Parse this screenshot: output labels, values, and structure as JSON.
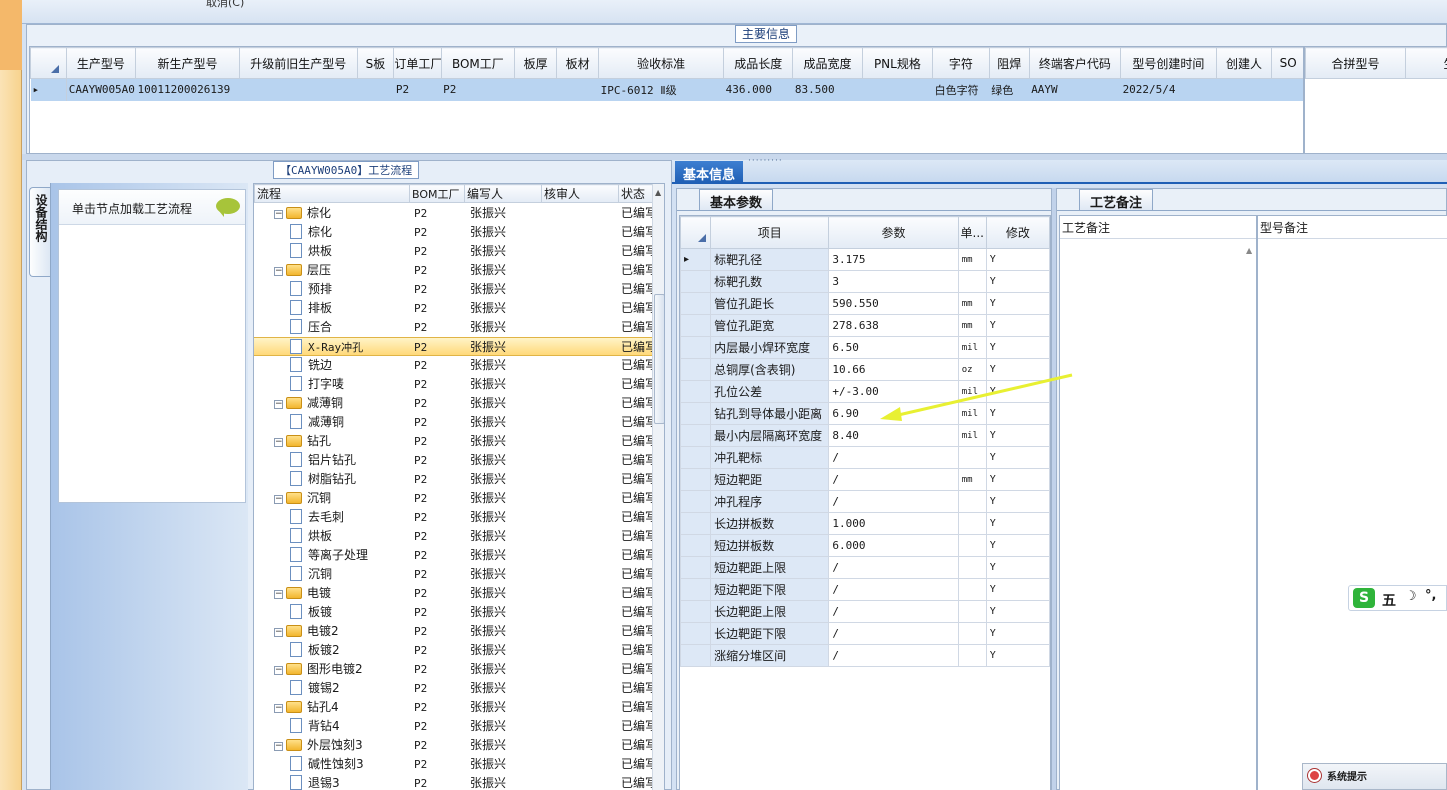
{
  "top_menu": {
    "cancel_label": "取消(C)"
  },
  "main_info": {
    "title": "主要信息",
    "columns": [
      "生产型号",
      "新生产型号",
      "升级前旧生产型号",
      "S板",
      "订单工厂",
      "BOM工厂",
      "板厚",
      "板材",
      "验收标准",
      "成品长度",
      "成品宽度",
      "PNL规格",
      "字符",
      "阻焊",
      "终端客户代码",
      "型号创建时间",
      "创建人",
      "SO"
    ],
    "row": [
      "CAAYW005A0",
      "10011200026139",
      "",
      "",
      "P2",
      "P2",
      "",
      "",
      "IPC-6012 Ⅱ级",
      "436.000",
      "83.500",
      "",
      "白色字符",
      "绿色",
      "AAYW",
      "2022/5/4",
      "",
      ""
    ],
    "right_columns": [
      "合拼型号",
      "生产"
    ]
  },
  "process": {
    "title": "【CAAYW005A0】工艺流程",
    "side_tab": "设备结构",
    "load_hint": "单击节点加载工艺流程",
    "columns": [
      "流程",
      "BOM工厂",
      "编写人",
      "核审人",
      "状态"
    ],
    "rows": [
      {
        "label": "棕化",
        "type": "folder",
        "bom": "P2",
        "writer": "张振兴",
        "reviewer": "",
        "status": "已编写"
      },
      {
        "label": "棕化",
        "type": "doc",
        "bom": "P2",
        "writer": "张振兴",
        "reviewer": "",
        "status": "已编写"
      },
      {
        "label": "烘板",
        "type": "doc",
        "bom": "P2",
        "writer": "张振兴",
        "reviewer": "",
        "status": "已编写"
      },
      {
        "label": "层压",
        "type": "folder",
        "bom": "P2",
        "writer": "张振兴",
        "reviewer": "",
        "status": "已编写"
      },
      {
        "label": "预排",
        "type": "doc",
        "bom": "P2",
        "writer": "张振兴",
        "reviewer": "",
        "status": "已编写"
      },
      {
        "label": "排板",
        "type": "doc",
        "bom": "P2",
        "writer": "张振兴",
        "reviewer": "",
        "status": "已编写"
      },
      {
        "label": "压合",
        "type": "doc",
        "bom": "P2",
        "writer": "张振兴",
        "reviewer": "",
        "status": "已编写"
      },
      {
        "label": "X-Ray冲孔",
        "type": "doc",
        "bom": "P2",
        "writer": "张振兴",
        "reviewer": "",
        "status": "已编写",
        "selected": true
      },
      {
        "label": "铣边",
        "type": "doc",
        "bom": "P2",
        "writer": "张振兴",
        "reviewer": "",
        "status": "已编写"
      },
      {
        "label": "打字唛",
        "type": "doc",
        "bom": "P2",
        "writer": "张振兴",
        "reviewer": "",
        "status": "已编写"
      },
      {
        "label": "减薄铜",
        "type": "folder",
        "bom": "P2",
        "writer": "张振兴",
        "reviewer": "",
        "status": "已编写"
      },
      {
        "label": "减薄铜",
        "type": "doc",
        "bom": "P2",
        "writer": "张振兴",
        "reviewer": "",
        "status": "已编写"
      },
      {
        "label": "钻孔",
        "type": "folder",
        "bom": "P2",
        "writer": "张振兴",
        "reviewer": "",
        "status": "已编写"
      },
      {
        "label": "铝片钻孔",
        "type": "doc",
        "bom": "P2",
        "writer": "张振兴",
        "reviewer": "",
        "status": "已编写"
      },
      {
        "label": "树脂钻孔",
        "type": "doc",
        "bom": "P2",
        "writer": "张振兴",
        "reviewer": "",
        "status": "已编写"
      },
      {
        "label": "沉铜",
        "type": "folder",
        "bom": "P2",
        "writer": "张振兴",
        "reviewer": "",
        "status": "已编写"
      },
      {
        "label": "去毛刺",
        "type": "doc",
        "bom": "P2",
        "writer": "张振兴",
        "reviewer": "",
        "status": "已编写"
      },
      {
        "label": "烘板",
        "type": "doc",
        "bom": "P2",
        "writer": "张振兴",
        "reviewer": "",
        "status": "已编写"
      },
      {
        "label": "等离子处理",
        "type": "doc",
        "bom": "P2",
        "writer": "张振兴",
        "reviewer": "",
        "status": "已编写"
      },
      {
        "label": "沉铜",
        "type": "doc",
        "bom": "P2",
        "writer": "张振兴",
        "reviewer": "",
        "status": "已编写"
      },
      {
        "label": "电镀",
        "type": "folder",
        "bom": "P2",
        "writer": "张振兴",
        "reviewer": "",
        "status": "已编写"
      },
      {
        "label": "板镀",
        "type": "doc",
        "bom": "P2",
        "writer": "张振兴",
        "reviewer": "",
        "status": "已编写"
      },
      {
        "label": "电镀2",
        "type": "folder",
        "bom": "P2",
        "writer": "张振兴",
        "reviewer": "",
        "status": "已编写"
      },
      {
        "label": "板镀2",
        "type": "doc",
        "bom": "P2",
        "writer": "张振兴",
        "reviewer": "",
        "status": "已编写"
      },
      {
        "label": "图形电镀2",
        "type": "folder",
        "bom": "P2",
        "writer": "张振兴",
        "reviewer": "",
        "status": "已编写"
      },
      {
        "label": "镀锡2",
        "type": "doc",
        "bom": "P2",
        "writer": "张振兴",
        "reviewer": "",
        "status": "已编写"
      },
      {
        "label": "钻孔4",
        "type": "folder",
        "bom": "P2",
        "writer": "张振兴",
        "reviewer": "",
        "status": "已编写"
      },
      {
        "label": "背钻4",
        "type": "doc",
        "bom": "P2",
        "writer": "张振兴",
        "reviewer": "",
        "status": "已编写"
      },
      {
        "label": "外层蚀刻3",
        "type": "folder",
        "bom": "P2",
        "writer": "张振兴",
        "reviewer": "",
        "status": "已编写"
      },
      {
        "label": "碱性蚀刻3",
        "type": "doc",
        "bom": "P2",
        "writer": "张振兴",
        "reviewer": "",
        "status": "已编写"
      },
      {
        "label": "退锡3",
        "type": "doc",
        "bom": "P2",
        "writer": "张振兴",
        "reviewer": "",
        "status": "已编写"
      }
    ]
  },
  "basic_info": {
    "tab": "基本信息",
    "subtab": "基本参数",
    "columns": [
      "项目",
      "参数",
      "单...",
      "修改"
    ],
    "rows": [
      {
        "name": "标靶孔径",
        "value": "3.175",
        "unit": "mm",
        "mod": "Y"
      },
      {
        "name": "标靶孔数",
        "value": "3",
        "unit": "",
        "mod": "Y"
      },
      {
        "name": "管位孔距长",
        "value": "590.550",
        "unit": "mm",
        "mod": "Y"
      },
      {
        "name": "管位孔距宽",
        "value": "278.638",
        "unit": "mm",
        "mod": "Y"
      },
      {
        "name": "内层最小焊环宽度",
        "value": "6.50",
        "unit": "mil",
        "mod": "Y"
      },
      {
        "name": "总铜厚(含表铜)",
        "value": "10.66",
        "unit": "oz",
        "mod": "Y"
      },
      {
        "name": "孔位公差",
        "value": "+/-3.00",
        "unit": "mil",
        "mod": "Y"
      },
      {
        "name": "钻孔到导体最小距离",
        "value": "6.90",
        "unit": "mil",
        "mod": "Y"
      },
      {
        "name": "最小内层隔离环宽度",
        "value": "8.40",
        "unit": "mil",
        "mod": "Y"
      },
      {
        "name": "冲孔靶标",
        "value": "/",
        "unit": "",
        "mod": "Y"
      },
      {
        "name": "短边靶距",
        "value": "/",
        "unit": "mm",
        "mod": "Y"
      },
      {
        "name": "冲孔程序",
        "value": "/",
        "unit": "",
        "mod": "Y"
      },
      {
        "name": "长边拼板数",
        "value": "1.000",
        "unit": "",
        "mod": "Y"
      },
      {
        "name": "短边拼板数",
        "value": "6.000",
        "unit": "",
        "mod": "Y"
      },
      {
        "name": "短边靶距上限",
        "value": "/",
        "unit": "",
        "mod": "Y"
      },
      {
        "name": "短边靶距下限",
        "value": "/",
        "unit": "",
        "mod": "Y"
      },
      {
        "name": "长边靶距上限",
        "value": "/",
        "unit": "",
        "mod": "Y"
      },
      {
        "name": "长边靶距下限",
        "value": "/",
        "unit": "",
        "mod": "Y"
      },
      {
        "name": "涨缩分堆区间",
        "value": "/",
        "unit": "",
        "mod": "Y"
      }
    ]
  },
  "notes": {
    "tab": "工艺备注",
    "process_note_label": "工艺备注",
    "model_note_label": "型号备注"
  },
  "ime": {
    "mode": "五"
  },
  "system_tip": {
    "title": "系统提示"
  },
  "colors": {
    "selection": "#b9d4f1",
    "tab_blue": "#1f5fb5",
    "arrow": "#e8f032"
  }
}
